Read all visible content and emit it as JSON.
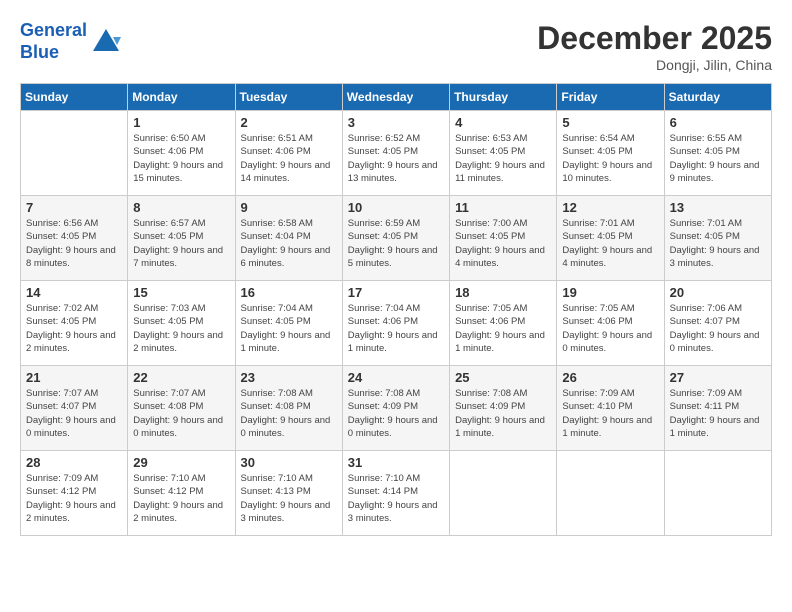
{
  "header": {
    "logo_line1": "General",
    "logo_line2": "Blue",
    "month": "December 2025",
    "location": "Dongji, Jilin, China"
  },
  "weekdays": [
    "Sunday",
    "Monday",
    "Tuesday",
    "Wednesday",
    "Thursday",
    "Friday",
    "Saturday"
  ],
  "weeks": [
    [
      {
        "day": "",
        "sunrise": "",
        "sunset": "",
        "daylight": ""
      },
      {
        "day": "1",
        "sunrise": "Sunrise: 6:50 AM",
        "sunset": "Sunset: 4:06 PM",
        "daylight": "Daylight: 9 hours and 15 minutes."
      },
      {
        "day": "2",
        "sunrise": "Sunrise: 6:51 AM",
        "sunset": "Sunset: 4:06 PM",
        "daylight": "Daylight: 9 hours and 14 minutes."
      },
      {
        "day": "3",
        "sunrise": "Sunrise: 6:52 AM",
        "sunset": "Sunset: 4:05 PM",
        "daylight": "Daylight: 9 hours and 13 minutes."
      },
      {
        "day": "4",
        "sunrise": "Sunrise: 6:53 AM",
        "sunset": "Sunset: 4:05 PM",
        "daylight": "Daylight: 9 hours and 11 minutes."
      },
      {
        "day": "5",
        "sunrise": "Sunrise: 6:54 AM",
        "sunset": "Sunset: 4:05 PM",
        "daylight": "Daylight: 9 hours and 10 minutes."
      },
      {
        "day": "6",
        "sunrise": "Sunrise: 6:55 AM",
        "sunset": "Sunset: 4:05 PM",
        "daylight": "Daylight: 9 hours and 9 minutes."
      }
    ],
    [
      {
        "day": "7",
        "sunrise": "Sunrise: 6:56 AM",
        "sunset": "Sunset: 4:05 PM",
        "daylight": "Daylight: 9 hours and 8 minutes."
      },
      {
        "day": "8",
        "sunrise": "Sunrise: 6:57 AM",
        "sunset": "Sunset: 4:05 PM",
        "daylight": "Daylight: 9 hours and 7 minutes."
      },
      {
        "day": "9",
        "sunrise": "Sunrise: 6:58 AM",
        "sunset": "Sunset: 4:04 PM",
        "daylight": "Daylight: 9 hours and 6 minutes."
      },
      {
        "day": "10",
        "sunrise": "Sunrise: 6:59 AM",
        "sunset": "Sunset: 4:05 PM",
        "daylight": "Daylight: 9 hours and 5 minutes."
      },
      {
        "day": "11",
        "sunrise": "Sunrise: 7:00 AM",
        "sunset": "Sunset: 4:05 PM",
        "daylight": "Daylight: 9 hours and 4 minutes."
      },
      {
        "day": "12",
        "sunrise": "Sunrise: 7:01 AM",
        "sunset": "Sunset: 4:05 PM",
        "daylight": "Daylight: 9 hours and 4 minutes."
      },
      {
        "day": "13",
        "sunrise": "Sunrise: 7:01 AM",
        "sunset": "Sunset: 4:05 PM",
        "daylight": "Daylight: 9 hours and 3 minutes."
      }
    ],
    [
      {
        "day": "14",
        "sunrise": "Sunrise: 7:02 AM",
        "sunset": "Sunset: 4:05 PM",
        "daylight": "Daylight: 9 hours and 2 minutes."
      },
      {
        "day": "15",
        "sunrise": "Sunrise: 7:03 AM",
        "sunset": "Sunset: 4:05 PM",
        "daylight": "Daylight: 9 hours and 2 minutes."
      },
      {
        "day": "16",
        "sunrise": "Sunrise: 7:04 AM",
        "sunset": "Sunset: 4:05 PM",
        "daylight": "Daylight: 9 hours and 1 minute."
      },
      {
        "day": "17",
        "sunrise": "Sunrise: 7:04 AM",
        "sunset": "Sunset: 4:06 PM",
        "daylight": "Daylight: 9 hours and 1 minute."
      },
      {
        "day": "18",
        "sunrise": "Sunrise: 7:05 AM",
        "sunset": "Sunset: 4:06 PM",
        "daylight": "Daylight: 9 hours and 1 minute."
      },
      {
        "day": "19",
        "sunrise": "Sunrise: 7:05 AM",
        "sunset": "Sunset: 4:06 PM",
        "daylight": "Daylight: 9 hours and 0 minutes."
      },
      {
        "day": "20",
        "sunrise": "Sunrise: 7:06 AM",
        "sunset": "Sunset: 4:07 PM",
        "daylight": "Daylight: 9 hours and 0 minutes."
      }
    ],
    [
      {
        "day": "21",
        "sunrise": "Sunrise: 7:07 AM",
        "sunset": "Sunset: 4:07 PM",
        "daylight": "Daylight: 9 hours and 0 minutes."
      },
      {
        "day": "22",
        "sunrise": "Sunrise: 7:07 AM",
        "sunset": "Sunset: 4:08 PM",
        "daylight": "Daylight: 9 hours and 0 minutes."
      },
      {
        "day": "23",
        "sunrise": "Sunrise: 7:08 AM",
        "sunset": "Sunset: 4:08 PM",
        "daylight": "Daylight: 9 hours and 0 minutes."
      },
      {
        "day": "24",
        "sunrise": "Sunrise: 7:08 AM",
        "sunset": "Sunset: 4:09 PM",
        "daylight": "Daylight: 9 hours and 0 minutes."
      },
      {
        "day": "25",
        "sunrise": "Sunrise: 7:08 AM",
        "sunset": "Sunset: 4:09 PM",
        "daylight": "Daylight: 9 hours and 1 minute."
      },
      {
        "day": "26",
        "sunrise": "Sunrise: 7:09 AM",
        "sunset": "Sunset: 4:10 PM",
        "daylight": "Daylight: 9 hours and 1 minute."
      },
      {
        "day": "27",
        "sunrise": "Sunrise: 7:09 AM",
        "sunset": "Sunset: 4:11 PM",
        "daylight": "Daylight: 9 hours and 1 minute."
      }
    ],
    [
      {
        "day": "28",
        "sunrise": "Sunrise: 7:09 AM",
        "sunset": "Sunset: 4:12 PM",
        "daylight": "Daylight: 9 hours and 2 minutes."
      },
      {
        "day": "29",
        "sunrise": "Sunrise: 7:10 AM",
        "sunset": "Sunset: 4:12 PM",
        "daylight": "Daylight: 9 hours and 2 minutes."
      },
      {
        "day": "30",
        "sunrise": "Sunrise: 7:10 AM",
        "sunset": "Sunset: 4:13 PM",
        "daylight": "Daylight: 9 hours and 3 minutes."
      },
      {
        "day": "31",
        "sunrise": "Sunrise: 7:10 AM",
        "sunset": "Sunset: 4:14 PM",
        "daylight": "Daylight: 9 hours and 3 minutes."
      },
      {
        "day": "",
        "sunrise": "",
        "sunset": "",
        "daylight": ""
      },
      {
        "day": "",
        "sunrise": "",
        "sunset": "",
        "daylight": ""
      },
      {
        "day": "",
        "sunrise": "",
        "sunset": "",
        "daylight": ""
      }
    ]
  ]
}
